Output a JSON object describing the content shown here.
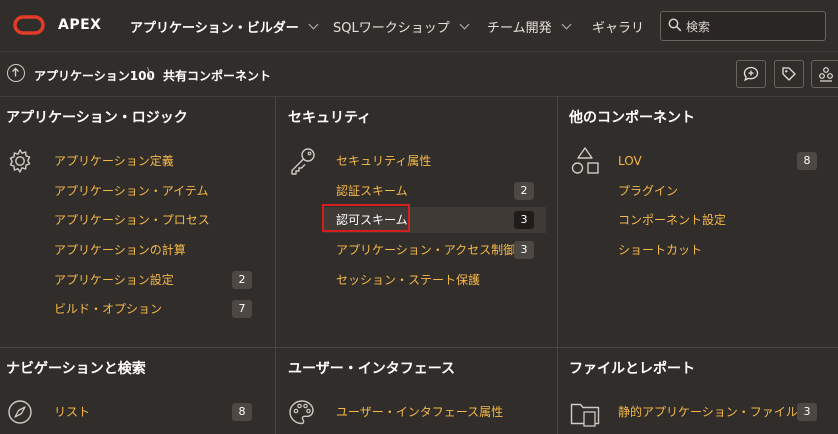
{
  "header": {
    "brand": "APEX",
    "nav": [
      {
        "label": "アプリケーション・ビルダー"
      },
      {
        "label": "SQLワークショップ"
      },
      {
        "label": "チーム開発"
      },
      {
        "label": "ギャラリ"
      }
    ],
    "search_placeholder": "検索"
  },
  "breadcrumb": {
    "parent": "アプリケーション100",
    "separator": "\\",
    "current": "共有コンポーネント"
  },
  "panels": {
    "app_logic": {
      "title": "アプリケーション・ロジック",
      "icon": "gear-icon",
      "items": [
        {
          "label": "アプリケーション定義",
          "count": ""
        },
        {
          "label": "アプリケーション・アイテム",
          "count": ""
        },
        {
          "label": "アプリケーション・プロセス",
          "count": ""
        },
        {
          "label": "アプリケーションの計算",
          "count": ""
        },
        {
          "label": "アプリケーション設定",
          "count": "2"
        },
        {
          "label": "ビルド・オプション",
          "count": "7"
        }
      ]
    },
    "security": {
      "title": "セキュリティ",
      "icon": "key-icon",
      "items": [
        {
          "label": "セキュリティ属性",
          "count": ""
        },
        {
          "label": "認証スキーム",
          "count": "2"
        },
        {
          "label": "認可スキーム",
          "count": "3"
        },
        {
          "label": "アプリケーション・アクセス制御",
          "count": "3"
        },
        {
          "label": "セッション・ステート保護",
          "count": ""
        }
      ]
    },
    "other": {
      "title": "他のコンポーネント",
      "icon": "shapes-icon",
      "items": [
        {
          "label": "LOV",
          "count": "8"
        },
        {
          "label": "プラグイン",
          "count": ""
        },
        {
          "label": "コンポーネント設定",
          "count": ""
        },
        {
          "label": "ショートカット",
          "count": ""
        }
      ]
    },
    "nav_search": {
      "title": "ナビゲーションと検索",
      "icon": "compass-icon",
      "items": [
        {
          "label": "リスト",
          "count": "8"
        }
      ]
    },
    "ui": {
      "title": "ユーザー・インタフェース",
      "icon": "palette-icon",
      "items": [
        {
          "label": "ユーザー・インタフェース属性",
          "count": ""
        }
      ]
    },
    "files": {
      "title": "ファイルとレポート",
      "icon": "folder-icon",
      "items": [
        {
          "label": "静的アプリケーション・ファイル",
          "count": "3"
        }
      ]
    }
  },
  "colors": {
    "background": "#312d2a",
    "link": "#f5b84a",
    "highlight_box": "#d41f1f"
  }
}
